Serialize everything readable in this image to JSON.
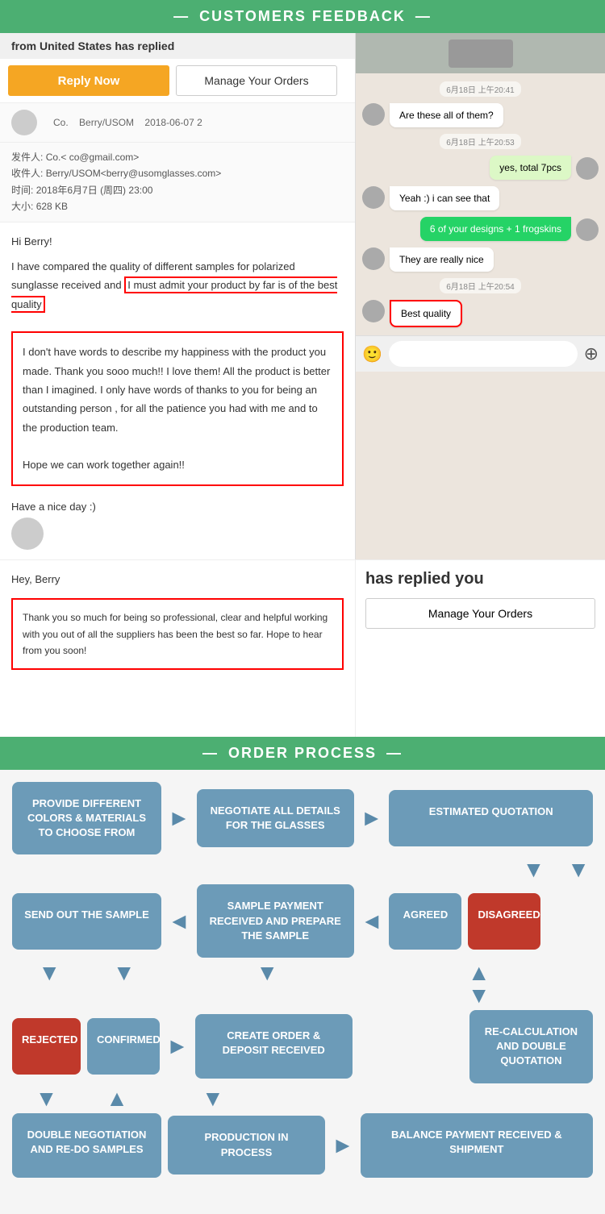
{
  "header": {
    "feedback_title": "CUSTOMERS FEEDBACK",
    "order_title": "ORDER PROCESS",
    "dash": "—"
  },
  "email": {
    "top_bar": "from United States has replied",
    "reply_btn": "Reply Now",
    "manage_btn": "Manage Your Orders",
    "meta_name": "Co.",
    "meta_to": "Berry/USOM",
    "meta_date": "2018-06-07 2",
    "from_label": "发件人:",
    "from_value": "Co.< co@gmail.com>",
    "to_label": "收件人:",
    "to_value": "Berry/USOM<berry@usomglasses.com>",
    "time_label": "时间:",
    "time_value": "2018年6月7日 (周四) 23:00",
    "size_label": "大小:",
    "size_value": "628 KB",
    "greeting": "Hi Berry!",
    "body_prefix": "I have compared the quality of different samples for polarized sunglasse received and",
    "body_highlight": "I must admit your product by far is of the best quality",
    "feedback_para1": "I don't have words to describe my happiness with the product you made. Thank you sooo much!! I love them! All the product is better than I imagined. I only have words of thanks to you for being an outstanding person , for all the patience you had with me and to the production team.",
    "feedback_para2": "Hope we can work together again!!",
    "sign_line": "Have a nice day :)",
    "greeting2": "Hey, Berry",
    "thankyou_text": "Thank you so much for being so professional, clear and helpful working with you out of all the suppliers has been the best so far. Hope to hear from you soon!",
    "has_replied": "has replied you",
    "manage_btn2": "Manage Your Orders"
  },
  "chat": {
    "timestamp1": "6月18日 上午20:41",
    "msg1": "Are these all of them?",
    "timestamp2": "6月18日 上午20:53",
    "msg2": "yes, total 7pcs",
    "msg3": "Yeah :) i can see that",
    "msg4": "6 of your designs + 1 frogskins",
    "msg5": "They are really nice",
    "timestamp3": "6月18日 上午20:54",
    "msg6": "Best quality"
  },
  "process": {
    "box1": "PROVIDE DIFFERENT COLORS & MATERIALS TO CHOOSE FROM",
    "box2": "NEGOTIATE ALL DETAILS FOR THE GLASSES",
    "box3": "ESTIMATED QUOTATION",
    "box4": "SEND OUT THE SAMPLE",
    "box5": "SAMPLE PAYMENT RECEIVED AND PREPARE THE SAMPLE",
    "box6": "AGREED",
    "box7": "DISAGREED",
    "box8": "REJECTED",
    "box9": "CONFIRMED",
    "box10": "CREATE ORDER & DEPOSIT RECEIVED",
    "box11": "RE-CALCULATION AND DOUBLE QUOTATION",
    "box12": "DOUBLE NEGOTIATION AND RE-DO SAMPLES",
    "box13": "PRODUCTION IN PROCESS",
    "box14": "BALANCE PAYMENT RECEIVED & SHIPMENT"
  }
}
